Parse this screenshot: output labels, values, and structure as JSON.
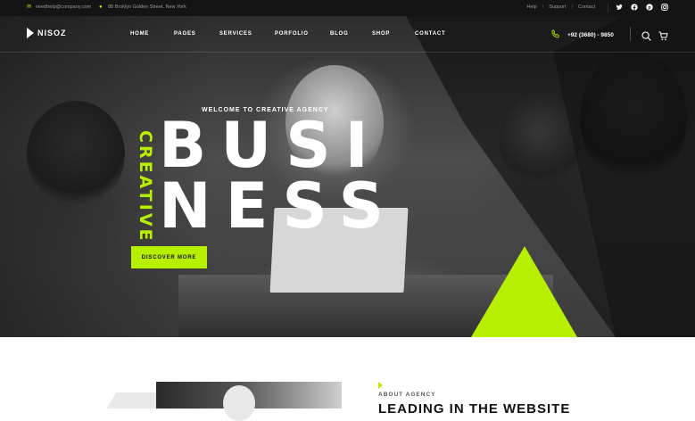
{
  "topbar": {
    "email": "needhelp@company.com",
    "address": "88 Broklyn Golden Street. New York",
    "links": [
      "Help",
      "Support",
      "Contact"
    ],
    "social": [
      "twitter-icon",
      "facebook-icon",
      "pinterest-icon",
      "instagram-icon"
    ]
  },
  "nav": {
    "logo": "NISOZ",
    "menu": [
      "HOME",
      "PAGES",
      "SERVICES",
      "PORFOLIO",
      "BLOG",
      "SHOP",
      "CONTACT"
    ],
    "phone": "+92 (3680) - 9850"
  },
  "hero": {
    "welcome": "WELCOME TO CREATIVE AGENCY",
    "line1": "BUSI",
    "line2": "NESS",
    "vertical": "CREATIVE",
    "button": "DISCOVER MORE"
  },
  "about": {
    "label": "ABOUT AGENCY",
    "title": "LEADING IN THE WEBSITE"
  },
  "colors": {
    "accent": "#b6f000",
    "dark": "#141414"
  }
}
